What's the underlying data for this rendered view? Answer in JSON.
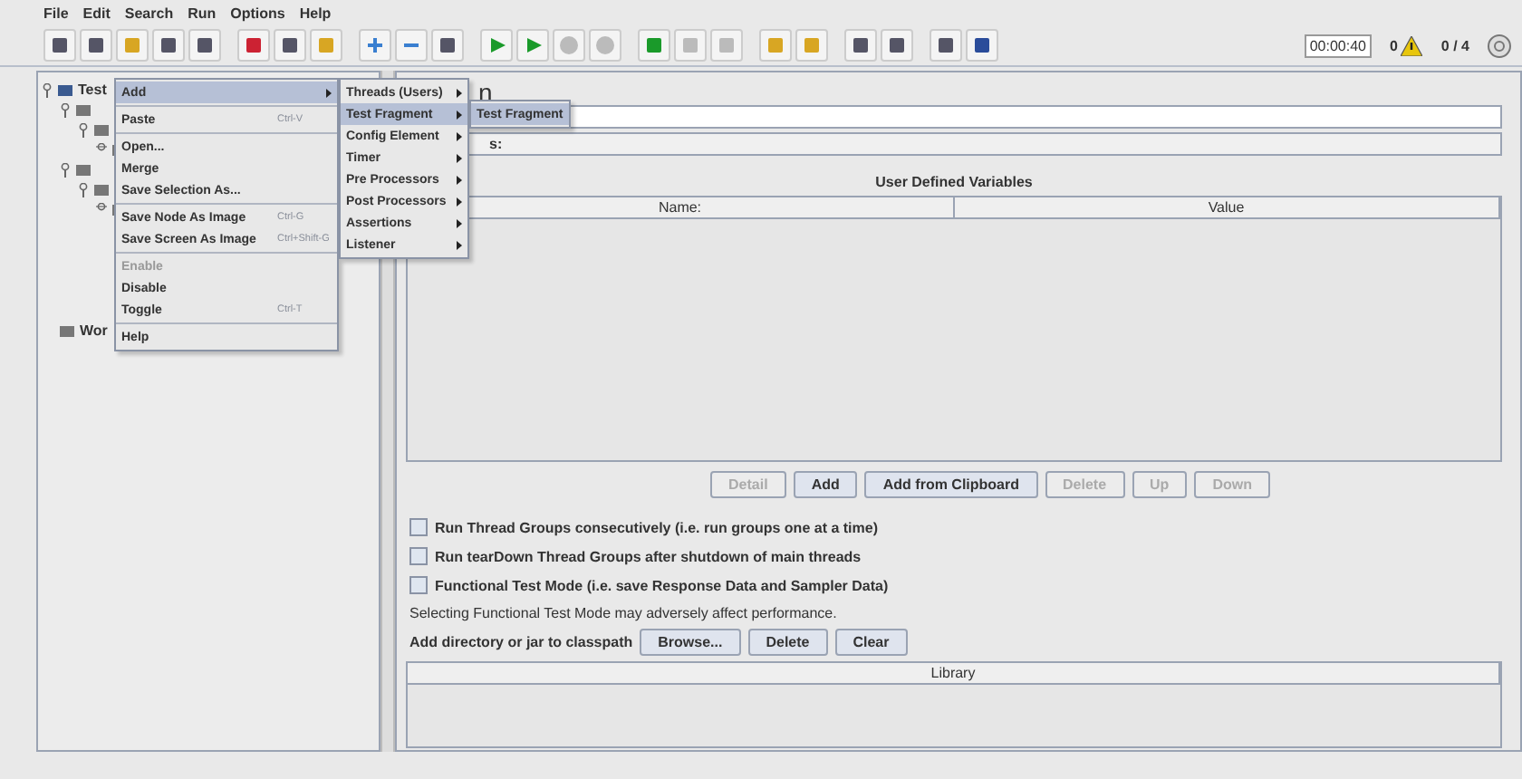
{
  "menu_bar": [
    "File",
    "Edit",
    "Search",
    "Run",
    "Options",
    "Help"
  ],
  "status": {
    "elapsed": "00:00:40",
    "warnings": "0",
    "threads": "0 / 4"
  },
  "tree": [
    {
      "label": "Test",
      "expanded": true,
      "children": [
        {
          "expanded": true,
          "children": [
            {
              "expanded": true,
              "children": [
                {
                  "expanded": false
                }
              ]
            }
          ]
        },
        {
          "expanded": true,
          "children": [
            {
              "expanded": true,
              "children": [
                {
                  "expanded": false
                }
              ]
            }
          ]
        }
      ]
    },
    {
      "label": "Wor"
    }
  ],
  "panel": {
    "title": "n",
    "comments_label": "s:",
    "variables_title": "User Defined Variables",
    "columns": [
      "Name:",
      "Value"
    ],
    "buttons": [
      {
        "label": "Detail",
        "disabled": true
      },
      {
        "label": "Add",
        "disabled": false
      },
      {
        "label": "Add from Clipboard",
        "disabled": false
      },
      {
        "label": "Delete",
        "disabled": true
      },
      {
        "label": "Up",
        "disabled": true
      },
      {
        "label": "Down",
        "disabled": true
      }
    ],
    "checkboxes": [
      {
        "label": "Run Thread Groups consecutively (i.e. run groups one at a time)",
        "checked": false
      },
      {
        "label": "Run tearDown Thread Groups after shutdown of main threads",
        "checked": false
      },
      {
        "label": "Functional Test Mode (i.e. save Response Data and Sampler Data)",
        "checked": false
      }
    ],
    "note": "Selecting Functional Test Mode may adversely affect performance.",
    "classpath_label": "Add directory or jar to classpath",
    "classpath_buttons": [
      "Browse...",
      "Delete",
      "Clear"
    ],
    "library_column": "Library"
  },
  "context_menu": [
    {
      "kind": "item",
      "label": "Add",
      "submenu": true,
      "selected": true,
      "disabled": false
    },
    {
      "kind": "separator"
    },
    {
      "kind": "item",
      "label": "Paste",
      "shortcut": "Ctrl-V",
      "selected": false,
      "disabled": false
    },
    {
      "kind": "separator"
    },
    {
      "kind": "item",
      "label": "Open...",
      "selected": false,
      "disabled": false
    },
    {
      "kind": "item",
      "label": "Merge",
      "selected": false,
      "disabled": false
    },
    {
      "kind": "item",
      "label": "Save Selection As...",
      "selected": false,
      "disabled": false
    },
    {
      "kind": "separator"
    },
    {
      "kind": "item",
      "label": "Save Node As Image",
      "shortcut": "Ctrl-G",
      "selected": false,
      "disabled": false
    },
    {
      "kind": "item",
      "label": "Save Screen As Image",
      "shortcut": "Ctrl+Shift-G",
      "selected": false,
      "disabled": false
    },
    {
      "kind": "separator"
    },
    {
      "kind": "item",
      "label": "Enable",
      "selected": false,
      "disabled": true
    },
    {
      "kind": "item",
      "label": "Disable",
      "selected": false,
      "disabled": false
    },
    {
      "kind": "item",
      "label": "Toggle",
      "shortcut": "Ctrl-T",
      "selected": false,
      "disabled": false
    },
    {
      "kind": "separator"
    },
    {
      "kind": "item",
      "label": "Help",
      "selected": false,
      "disabled": false
    }
  ],
  "add_submenu": [
    {
      "label": "Threads (Users)",
      "selected": false
    },
    {
      "label": "Test Fragment",
      "selected": true
    },
    {
      "label": "Config Element",
      "selected": false
    },
    {
      "label": "Timer",
      "selected": false
    },
    {
      "label": "Pre Processors",
      "selected": false
    },
    {
      "label": "Post Processors",
      "selected": false
    },
    {
      "label": "Assertions",
      "selected": false
    },
    {
      "label": "Listener",
      "selected": false
    }
  ],
  "fragment_submenu": [
    {
      "label": "Test Fragment",
      "selected": true
    }
  ]
}
